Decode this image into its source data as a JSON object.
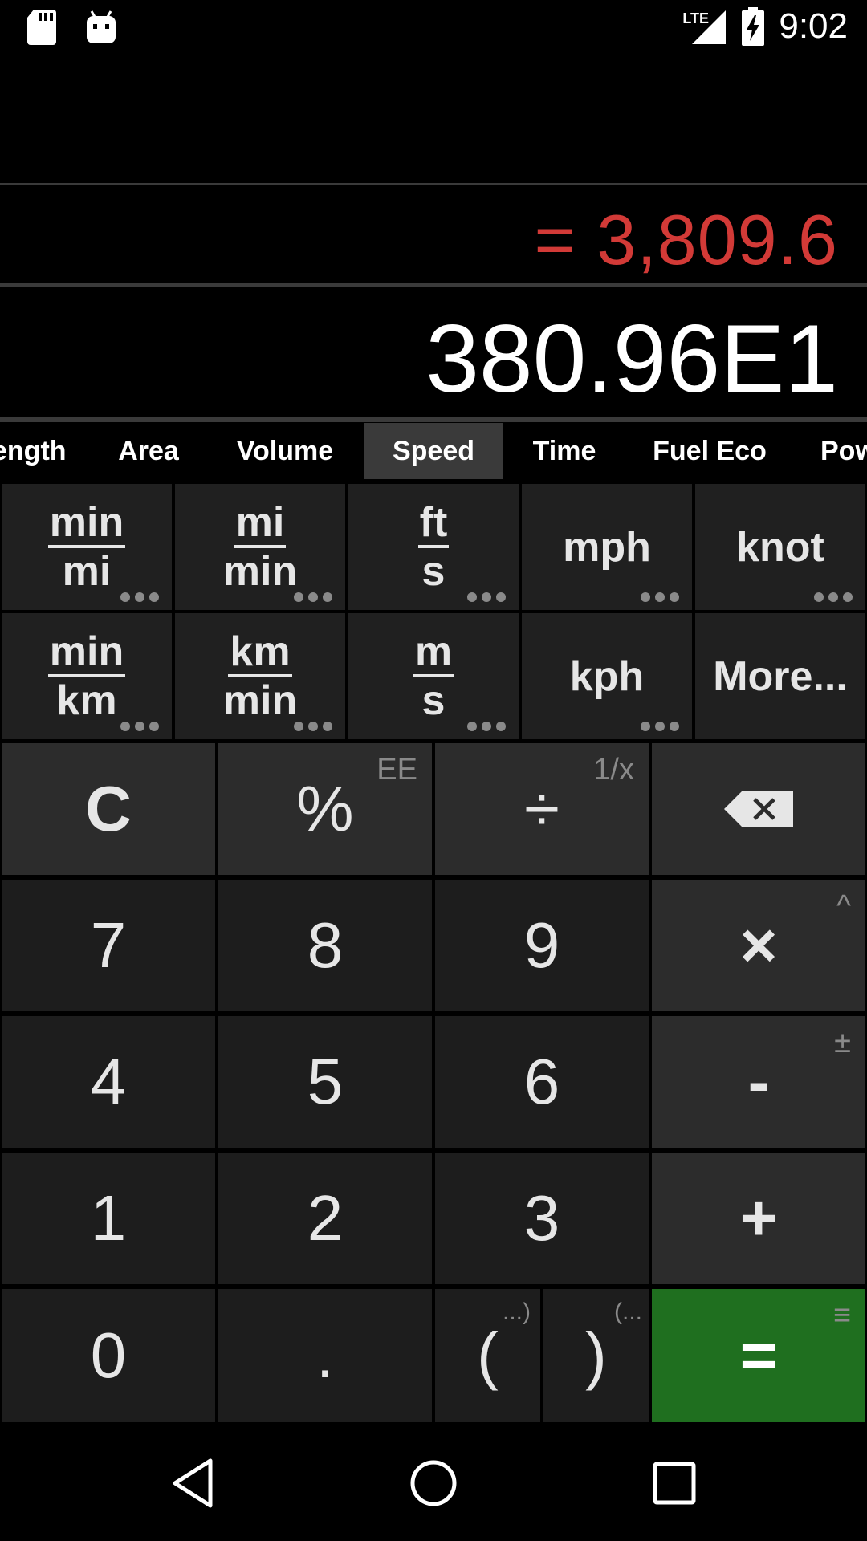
{
  "status_bar": {
    "network": "LTE",
    "time": "9:02",
    "icons": [
      "sd-card-icon",
      "android-debug-icon",
      "signal-icon",
      "battery-charging-icon"
    ]
  },
  "display": {
    "result": "= 3,809.6",
    "expression": "380.96E1",
    "result_color": "#d23a37"
  },
  "tabs": [
    {
      "label": "Length",
      "visible_label": "ength"
    },
    {
      "label": "Area"
    },
    {
      "label": "Volume"
    },
    {
      "label": "Speed",
      "active": true
    },
    {
      "label": "Time"
    },
    {
      "label": "Fuel Eco"
    },
    {
      "label": "Pow"
    }
  ],
  "units": {
    "row1": [
      {
        "num": "min",
        "den": "mi"
      },
      {
        "num": "mi",
        "den": "min"
      },
      {
        "num": "ft",
        "den": "s"
      },
      {
        "label": "mph"
      },
      {
        "label": "knot"
      }
    ],
    "row2": [
      {
        "num": "min",
        "den": "km"
      },
      {
        "num": "km",
        "den": "min"
      },
      {
        "num": "m",
        "den": "s"
      },
      {
        "label": "kph"
      },
      {
        "label": "More..."
      }
    ]
  },
  "keys": {
    "clear": "C",
    "percent": "%",
    "percent_alt": "EE",
    "divide": "÷",
    "divide_alt": "1/x",
    "seven": "7",
    "eight": "8",
    "nine": "9",
    "multiply": "×",
    "multiply_alt": "^",
    "four": "4",
    "five": "5",
    "six": "6",
    "minus": "-",
    "minus_alt": "±",
    "one": "1",
    "two": "2",
    "three": "3",
    "plus": "+",
    "zero": "0",
    "decimal": ".",
    "open_paren": "(",
    "open_paren_alt": "...)",
    "close_paren": ")",
    "close_paren_alt": "(...",
    "equals": "=",
    "equals_alt": "≡"
  },
  "colors": {
    "accent_green": "#1f6f1f",
    "result_red": "#d23a37"
  }
}
